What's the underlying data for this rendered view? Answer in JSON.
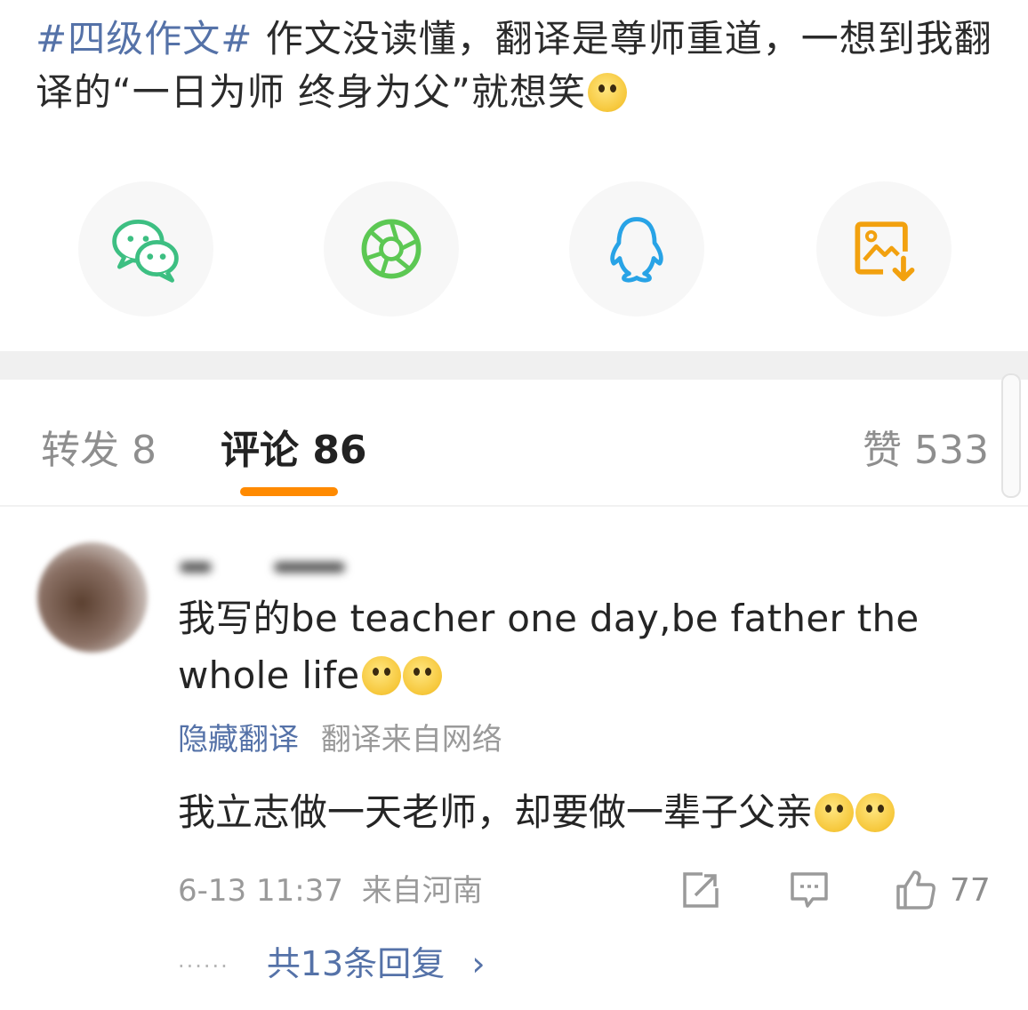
{
  "post": {
    "hashtag": "#四级作文#",
    "text": " 作文没读懂，翻译是尊师重道，一想到我翻译的“一日为师 终身为父”就想笑"
  },
  "share": {
    "items": [
      "wechat-icon",
      "moments-icon",
      "qq-icon",
      "save-image-icon"
    ],
    "colors": {
      "wechat": "#3dbf82",
      "moments": "#5cc853",
      "qq": "#28a3e6",
      "save": "#f2a10f"
    }
  },
  "tabs": {
    "repost": "转发 8",
    "comments": "评论 86",
    "likes": "赞 533",
    "accent": "#ff8a00"
  },
  "comment": {
    "text": "我写的be teacher one day,be father the whole life",
    "hide_translation": "隐藏翻译",
    "translation_source": "翻译来自网络",
    "translated_text": "我立志做一天老师，却要做一辈子父亲",
    "time": "6-13 11:37",
    "location": "来自河南",
    "like_count": "77",
    "replies": "共13条回复",
    "replies_chevron": "›",
    "dots": "······"
  }
}
